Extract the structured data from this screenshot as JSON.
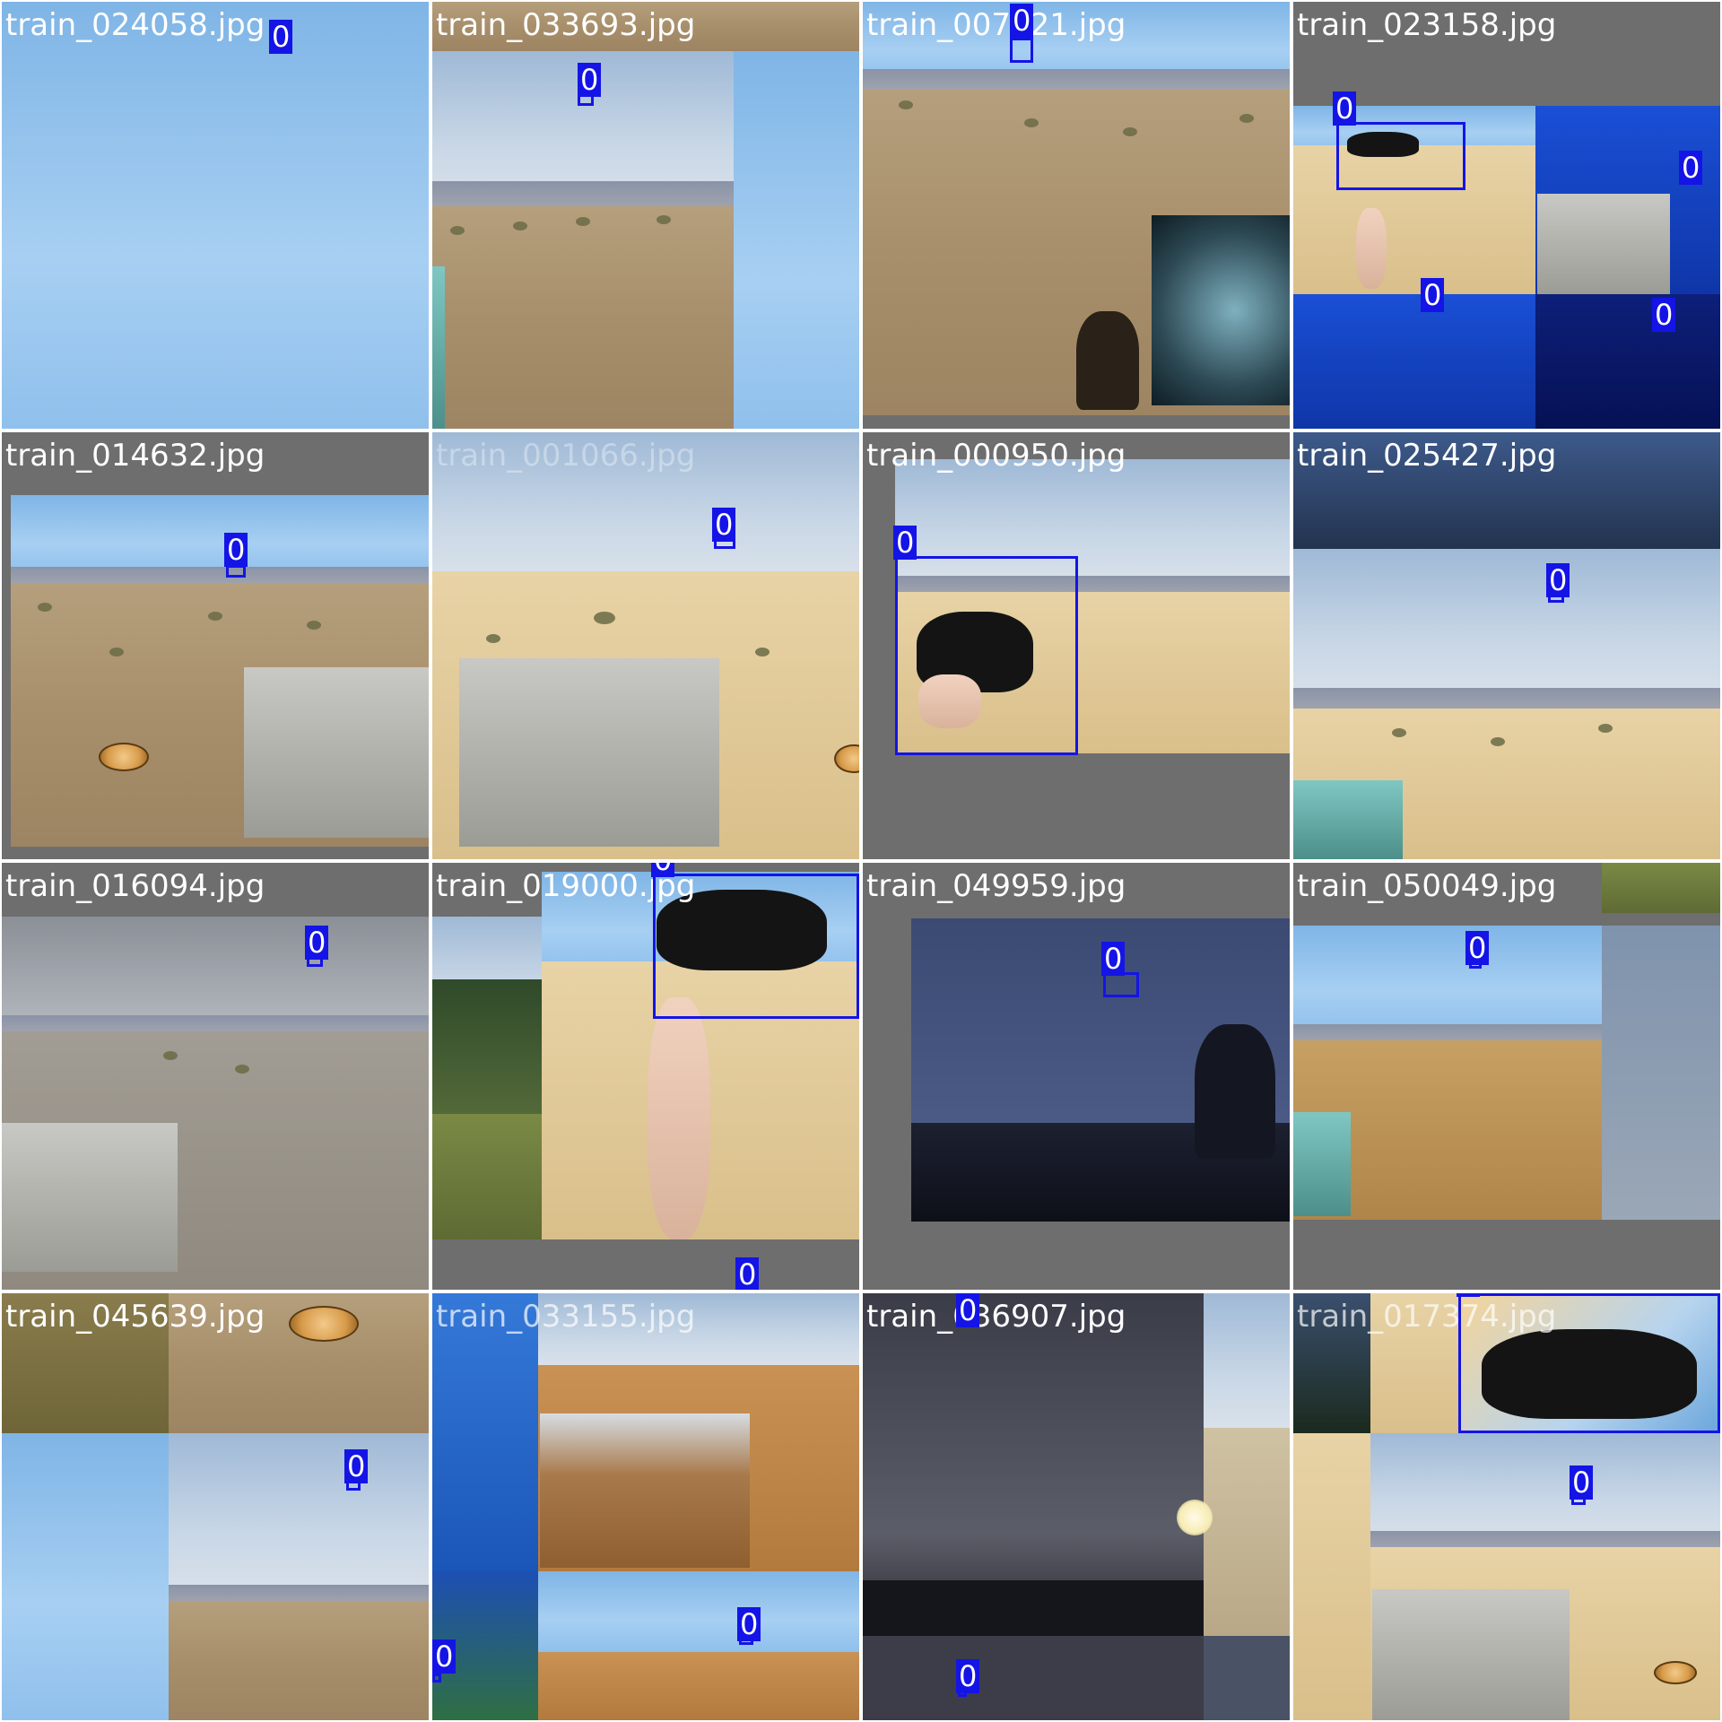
{
  "mosaic": {
    "tiles": [
      {
        "filename": "train_024058.jpg"
      },
      {
        "filename": "train_033693.jpg"
      },
      {
        "filename": "train_007021.jpg"
      },
      {
        "filename": "train_023158.jpg"
      },
      {
        "filename": "train_014632.jpg"
      },
      {
        "filename": "train_001066.jpg"
      },
      {
        "filename": "train_000950.jpg"
      },
      {
        "filename": "train_025427.jpg"
      },
      {
        "filename": "train_016094.jpg"
      },
      {
        "filename": "train_019000.jpg"
      },
      {
        "filename": "train_049959.jpg"
      },
      {
        "filename": "train_050049.jpg"
      },
      {
        "filename": "train_045639.jpg"
      },
      {
        "filename": "train_033155.jpg"
      },
      {
        "filename": "train_036907.jpg"
      },
      {
        "filename": "train_017374.jpg"
      }
    ],
    "class_label": "0",
    "box_color": "#1414e6"
  }
}
